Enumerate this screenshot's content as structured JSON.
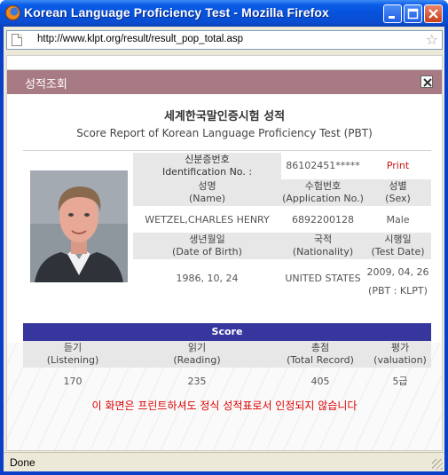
{
  "window": {
    "title": "Korean Language Proficiency Test - Mozilla Firefox"
  },
  "browser": {
    "url": "http://www.klpt.org/result/result_pop_total.asp",
    "status": "Done"
  },
  "popup": {
    "title": "성적조회"
  },
  "report": {
    "title_ko": "세계한국말인증시험 성적",
    "title_en": "Score Report of Korean Language Proficiency Test (PBT)",
    "id_label_ko": "신분증번호",
    "id_label_en": "Identification No. :",
    "id_value": "86102451*****",
    "print_label": "Print",
    "name_label_ko": "성명",
    "name_label_en": "(Name)",
    "app_label_ko": "수험번호",
    "app_label_en": "(Application No.)",
    "sex_label_ko": "성별",
    "sex_label_en": "(Sex)",
    "name_value": "WETZEL,CHARLES HENRY",
    "app_value": "6892200128",
    "sex_value": "Male",
    "dob_label_ko": "생년월일",
    "dob_label_en": "(Date of Birth)",
    "nat_label_ko": "국적",
    "nat_label_en": "(Nationality)",
    "testdate_label_ko": "시행일",
    "testdate_label_en": "(Test Date)",
    "dob_value": "1986, 10, 24",
    "nat_value": "UNITED STATES",
    "testdate_value": "2009, 04, 26",
    "testdate_note": "(PBT : KLPT)"
  },
  "score": {
    "header": "Score",
    "columns": [
      {
        "ko": "듣기",
        "en": "(Listening)",
        "value": "170"
      },
      {
        "ko": "읽기",
        "en": "(Reading)",
        "value": "235"
      },
      {
        "ko": "총점",
        "en": "(Total Record)",
        "value": "405"
      },
      {
        "ko": "평가",
        "en": "(valuation)",
        "value": "5급"
      }
    ]
  },
  "notice": "이 화면은 프린트하셔도 정식 성적표로서 인정되지 않습니다",
  "colors": {
    "accent_bar": "#36369e",
    "popup_header": "#a87a84",
    "notice": "#dd0000"
  }
}
